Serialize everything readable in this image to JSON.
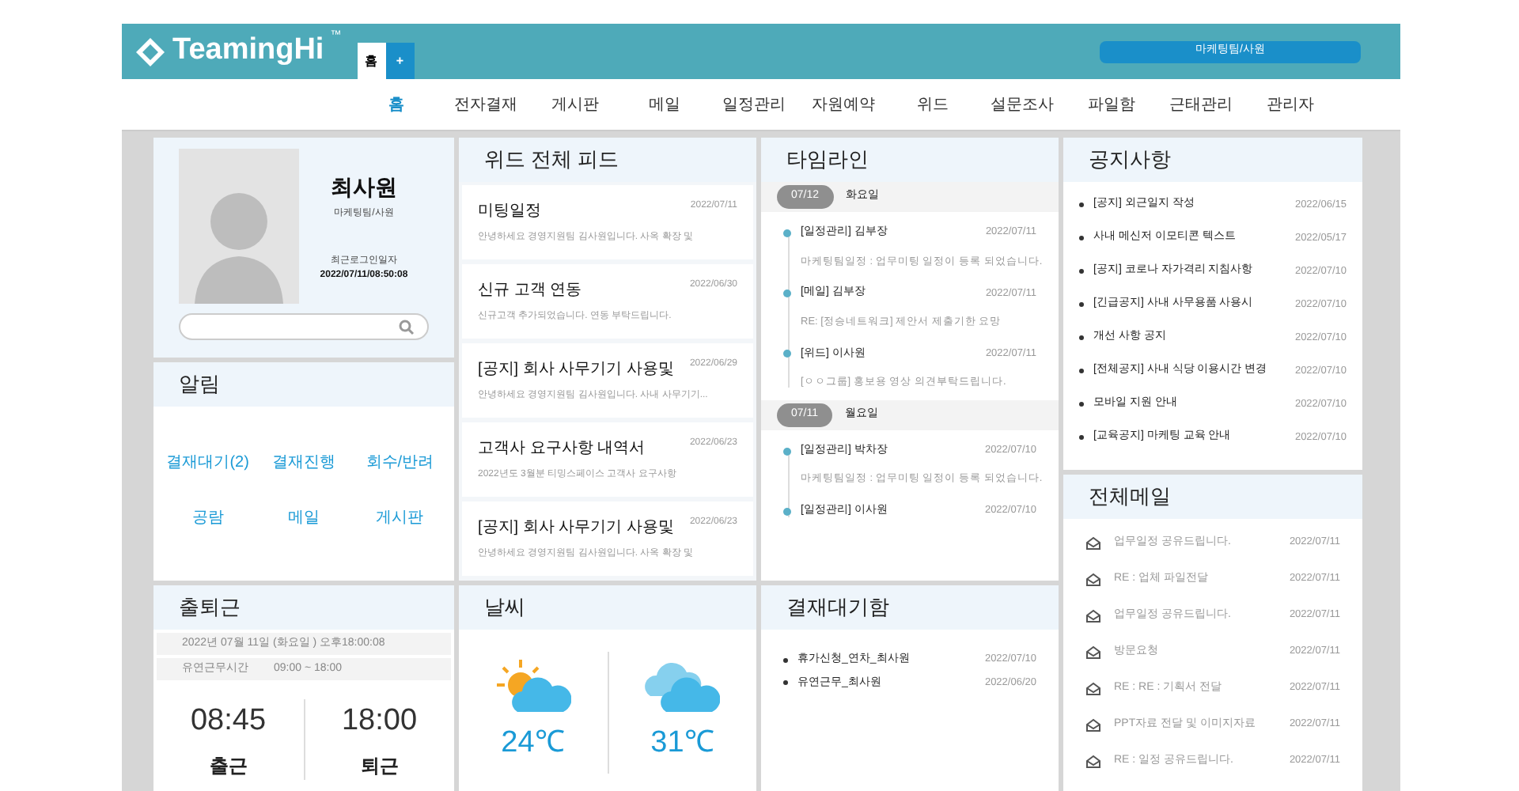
{
  "header": {
    "logo": "TeamingHi",
    "logo_mark": "™",
    "tabs": [
      {
        "label": "홈",
        "selected": true
      },
      {
        "label": "+",
        "selected": false
      }
    ],
    "user_badge": "마케팅팀/사원"
  },
  "nav": [
    {
      "label": "홈",
      "selected": true
    },
    {
      "label": "전자결재",
      "selected": false
    },
    {
      "label": "게시판",
      "selected": false
    },
    {
      "label": "메일",
      "selected": false
    },
    {
      "label": "일정관리",
      "selected": false
    },
    {
      "label": "자원예약",
      "selected": false
    },
    {
      "label": "위드",
      "selected": false
    },
    {
      "label": "설문조사",
      "selected": false
    },
    {
      "label": "파일함",
      "selected": false
    },
    {
      "label": "근태관리",
      "selected": false
    },
    {
      "label": "관리자",
      "selected": false
    }
  ],
  "profile": {
    "name": "최사원",
    "dept": "마케팅팀/사원",
    "login_label": "최근로그인일자",
    "login_time": "2022/07/11/08:50:08"
  },
  "alerts": {
    "title": "알림",
    "items": [
      "결재대기(2)",
      "결재진행",
      "회수/반려",
      "공람",
      "메일",
      "게시판"
    ]
  },
  "commute": {
    "title": "출퇴근",
    "date_line": "2022년 07월 11일 (화요일 ) 오후18:00:08",
    "work_label": "유연근무시간",
    "work_hours": "09:00 ~ 18:00",
    "times": [
      {
        "time": "08:45",
        "label": "출근"
      },
      {
        "time": "18:00",
        "label": "퇴근"
      }
    ]
  },
  "feed": {
    "title": "위드 전체 피드",
    "items": [
      {
        "title": "미팅일정",
        "date": "2022/07/11",
        "desc": "안녕하세요 경영지원팀 김사원입니다. 사옥 확장 및"
      },
      {
        "title": "신규 고객 연동",
        "date": "2022/06/30",
        "desc": "신규고객 추가되었습니다. 연동 부탁드립니다."
      },
      {
        "title": "[공지] 회사 사무기기 사용및",
        "date": "2022/06/29",
        "desc": "안녕하세요 경영지원팀 김사원입니다. 사내 사무기기..."
      },
      {
        "title": "고객사 요구사항 내역서",
        "date": "2022/06/23",
        "desc": "2022년도 3월분 티밍스페이스 고객사 요구사항"
      },
      {
        "title": "[공지] 회사 사무기기 사용및",
        "date": "2022/06/23",
        "desc": "안녕하세요 경영지원팀 김사원입니다. 사옥 확장 및"
      }
    ]
  },
  "weather": {
    "title": "날씨",
    "items": [
      {
        "kind": "sun_cloud",
        "temp": "24℃"
      },
      {
        "kind": "cloud",
        "temp": "31℃"
      }
    ]
  },
  "timeline": {
    "title": "타임라인",
    "groups": [
      {
        "date": "07/12",
        "day": "화요일",
        "entries": [
          {
            "title": "[일정관리] 김부장",
            "date": "2022/07/11",
            "desc": "마케팅팀일정 : 업무미팅 일정이 등록 되었습니다."
          },
          {
            "title": "[메일] 김부장",
            "date": "2022/07/11",
            "desc": "RE: [정승네트워크] 제안서 제출기한 요망"
          },
          {
            "title": "[위드] 이사원",
            "date": "2022/07/11",
            "desc": "[ㅇㅇ그룹] 홍보용 영상 의견부탁드립니다."
          }
        ]
      },
      {
        "date": "07/11",
        "day": "월요일",
        "entries": [
          {
            "title": "[일정관리] 박차장",
            "date": "2022/07/10",
            "desc": "마케팅팀일정 : 업무미팅 일정이 등록 되었습니다."
          },
          {
            "title": "[일정관리] 이사원",
            "date": "2022/07/10"
          }
        ]
      }
    ]
  },
  "approvals": {
    "title": "결재대기함",
    "items": [
      {
        "title": "휴가신청_연차_최사원",
        "date": "2022/07/10"
      },
      {
        "title": "유연근무_최사원",
        "date": "2022/06/20"
      }
    ]
  },
  "notices": {
    "title": "공지사항",
    "items": [
      {
        "title": "[공지] 외근일지 작성",
        "date": "2022/06/15"
      },
      {
        "title": "사내 메신저 이모티콘 텍스트",
        "date": "2022/05/17"
      },
      {
        "title": "[공지] 코로나 자가격리 지침사항",
        "date": "2022/07/10"
      },
      {
        "title": "[긴급공지] 사내 사무용품 사용시",
        "date": "2022/07/10"
      },
      {
        "title": "개선 사항 공지",
        "date": "2022/07/10"
      },
      {
        "title": "[전체공지] 사내 식당 이용시간 변경",
        "date": "2022/07/10"
      },
      {
        "title": "모바일 지원 안내",
        "date": "2022/07/10"
      },
      {
        "title": "[교육공지] 마케팅 교육 안내",
        "date": "2022/07/10"
      }
    ]
  },
  "mail": {
    "title": "전체메일",
    "items": [
      {
        "subject": "업무일정 공유드립니다.",
        "date": "2022/07/11"
      },
      {
        "subject": "RE : 업체 파일전달",
        "date": "2022/07/11"
      },
      {
        "subject": "업무일정 공유드립니다.",
        "date": "2022/07/11"
      },
      {
        "subject": "방문요청",
        "date": "2022/07/11"
      },
      {
        "subject": "RE : RE : 기획서 전달",
        "date": "2022/07/11"
      },
      {
        "subject": "PPT자료 전달 및 이미지자료",
        "date": "2022/07/11"
      },
      {
        "subject": "RE : 일정 공유드립니다.",
        "date": "2022/07/11"
      }
    ]
  }
}
